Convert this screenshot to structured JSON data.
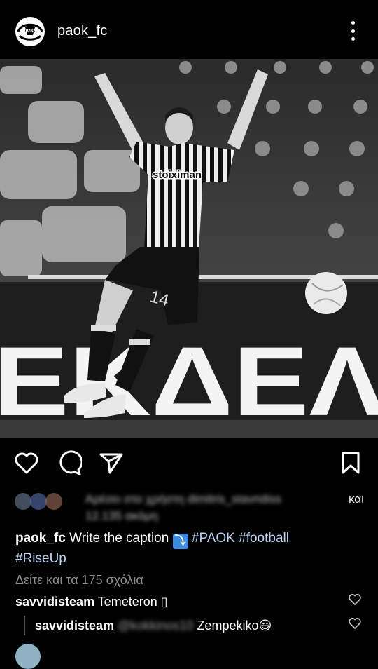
{
  "header": {
    "username": "paok_fc",
    "avatar_icon": "paok-logo-icon",
    "more_icon": "more-vertical-icon"
  },
  "post": {
    "image_description_icon": "player-photo",
    "actions": {
      "like_icon": "heart-icon",
      "comment_icon": "comment-icon",
      "share_icon": "send-icon",
      "save_icon": "bookmark-icon"
    },
    "likes": {
      "line1_blurred": "Αρέσει στο χρήστη dimitris_stavridiss",
      "line1_suffix": "και",
      "line2_blurred": "12.135 ακόμη"
    },
    "caption": {
      "username": "paok_fc",
      "text": "Write the caption",
      "emoji": "⤵",
      "hashtag1": "#PAOK",
      "hashtag2": "#football",
      "hashtag3": "#RiseUp"
    },
    "view_comments": "Δείτε και τα 175 σχόλια",
    "comments": [
      {
        "username": "savvidisteam",
        "text": "Temeteron ▯"
      },
      {
        "username": "savvidisteam",
        "mention_blurred": "@kokkinos10",
        "text": "Zempekiko😃"
      }
    ]
  },
  "colors": {
    "background": "#000000",
    "hashtag": "#b8d2f2",
    "muted": "#8e8e8e"
  }
}
